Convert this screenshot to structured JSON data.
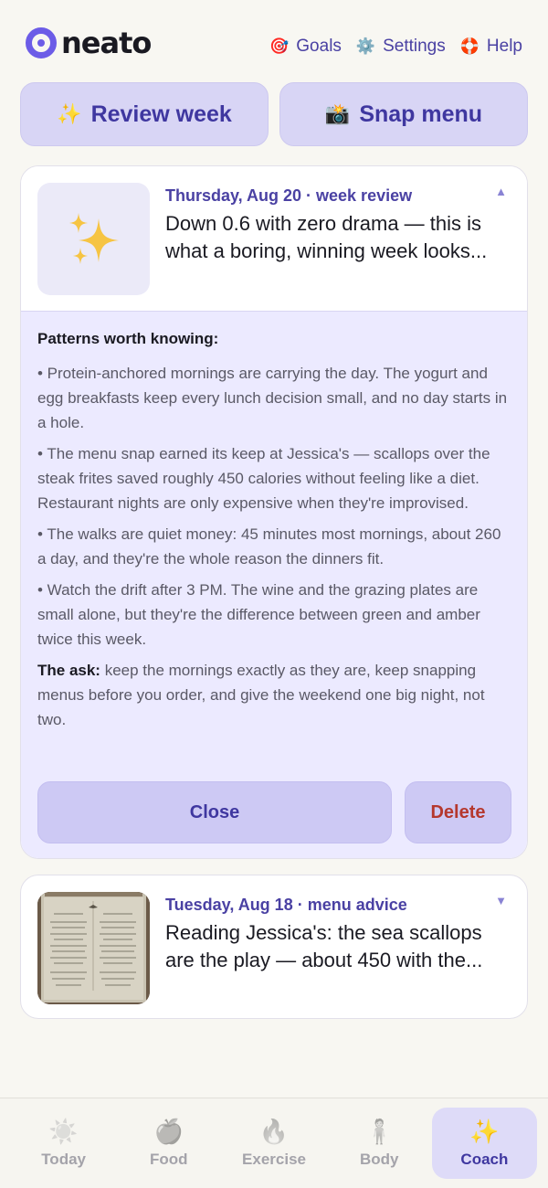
{
  "app": {
    "logo_text": "neato",
    "accent": "#6c5ce7"
  },
  "header": {
    "links": [
      {
        "label": "Goals",
        "icon": "target-icon"
      },
      {
        "label": "Settings",
        "icon": "gear-icon"
      },
      {
        "label": "Help",
        "icon": "lifebuoy-icon"
      }
    ]
  },
  "actions": {
    "review_week": {
      "label": "Review week",
      "icon": "sparkles-icon"
    },
    "snap_menu": {
      "label": "Snap menu",
      "icon": "camera-flash-icon"
    }
  },
  "cards": [
    {
      "meta": "Thursday, Aug 20 · week review",
      "headline": "Down 0.6 with zero drama — this is what a boring, winning week looks...",
      "expanded": true,
      "patterns_title": "Patterns worth knowing:",
      "bullets": [
        "• Protein-anchored mornings are carrying the day. The yogurt and egg breakfasts keep every lunch decision small, and no day starts in a hole.",
        "• The menu snap earned its keep at Jessica's — scallops over the steak frites saved roughly 450 calories without feeling like a diet. Restaurant nights are only expensive when they're improvised.",
        "• The walks are quiet money: 45 minutes most mornings, about 260 a day, and they're the whole reason the dinners fit.",
        "• Watch the drift after 3 PM. The wine and the grazing plates are small alone, but they're the difference between green and amber twice this week."
      ],
      "ask_label": "The ask:",
      "ask_text": " keep the mornings exactly as they are, keep snapping menus before you order, and give the weekend one big night, not two.",
      "close_label": "Close",
      "delete_label": "Delete"
    },
    {
      "meta": "Tuesday, Aug 18 · menu advice",
      "headline": "Reading Jessica's: the sea scallops are the play — about 450 with the...",
      "expanded": false
    }
  ],
  "bottom_nav": [
    {
      "label": "Today",
      "icon": "sun-icon",
      "active": false
    },
    {
      "label": "Food",
      "icon": "apple-icon",
      "active": false
    },
    {
      "label": "Exercise",
      "icon": "flame-icon",
      "active": false
    },
    {
      "label": "Body",
      "icon": "person-icon",
      "active": false
    },
    {
      "label": "Coach",
      "icon": "sparkles-icon",
      "active": true
    }
  ]
}
